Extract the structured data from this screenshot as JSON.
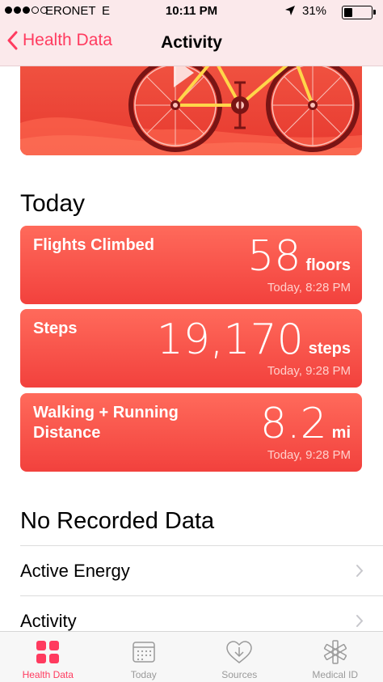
{
  "status": {
    "carrier": "ERONET",
    "network": "E",
    "time": "10:11 PM",
    "battery_pct": "31%",
    "battery_level": 0.31
  },
  "nav": {
    "back_label": "Health Data",
    "title": "Activity"
  },
  "today": {
    "title": "Today",
    "cards": [
      {
        "label": "Flights Climbed",
        "value": "58",
        "unit": "floors",
        "time": "Today, 8:28 PM"
      },
      {
        "label": "Steps",
        "value": "19,170",
        "unit": "steps",
        "time": "Today, 9:28 PM"
      },
      {
        "label": "Walking + Running Distance",
        "value": "8.2",
        "unit": "mi",
        "time": "Today, 9:28 PM"
      }
    ]
  },
  "no_data": {
    "title": "No Recorded Data",
    "items": [
      {
        "label": "Active Energy"
      },
      {
        "label": "Activity"
      }
    ]
  },
  "tabs": [
    {
      "label": "Health Data",
      "icon": "grid-icon",
      "active": true
    },
    {
      "label": "Today",
      "icon": "calendar-icon",
      "active": false
    },
    {
      "label": "Sources",
      "icon": "download-heart-icon",
      "active": false
    },
    {
      "label": "Medical ID",
      "icon": "medical-star-icon",
      "active": false
    }
  ],
  "colors": {
    "accent": "#ff3b5f",
    "card": "#f2413d"
  }
}
